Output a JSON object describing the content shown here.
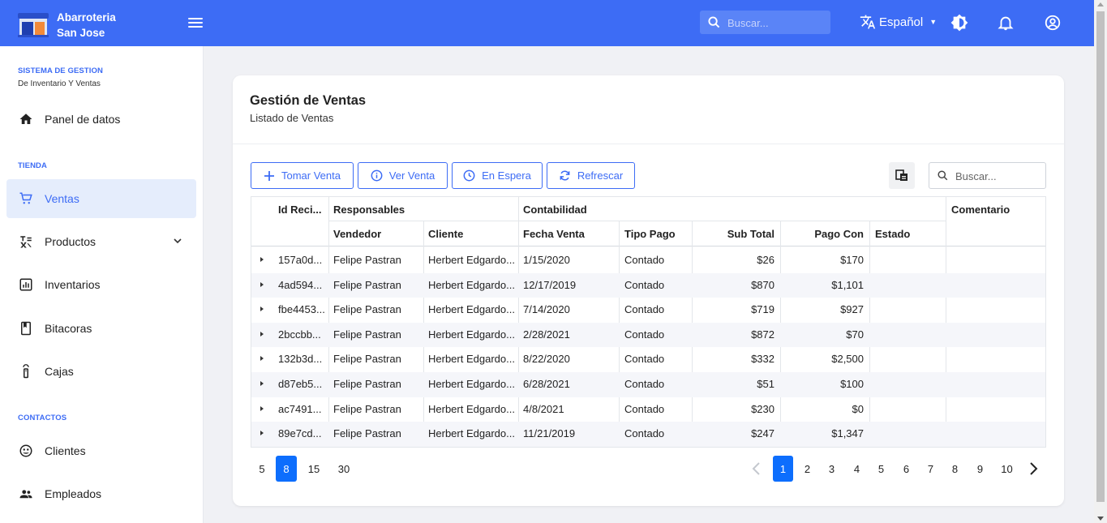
{
  "header": {
    "brand_line1": "Abarroteria",
    "brand_line2": "San Jose",
    "search_placeholder": "Buscar...",
    "language": "Español",
    "accent_color": "#3d6cf5",
    "icons": [
      "menu-icon",
      "search-icon",
      "translate-icon",
      "theme-toggle-icon",
      "bell-icon",
      "account-icon"
    ]
  },
  "sidebar": {
    "system_title": "SISTEMA DE GESTION",
    "system_subtitle": "De Inventario Y Ventas",
    "dashboard_label": "Panel de datos",
    "store_section": "TIENDA",
    "store_items": [
      {
        "label": "Ventas",
        "icon": "cart-icon",
        "active": true
      },
      {
        "label": "Productos",
        "icon": "products-icon",
        "has_submenu": true
      },
      {
        "label": "Inventarios",
        "icon": "chart-icon"
      },
      {
        "label": "Bitacoras",
        "icon": "book-icon"
      },
      {
        "label": "Cajas",
        "icon": "cash-register-icon"
      }
    ],
    "contacts_section": "CONTACTOS",
    "contact_items": [
      {
        "label": "Clientes",
        "icon": "clients-icon"
      },
      {
        "label": "Empleados",
        "icon": "employees-icon"
      }
    ]
  },
  "card": {
    "title": "Gestión de Ventas",
    "subtitle": "Listado de Ventas",
    "buttons": {
      "take_sale": "Tomar Venta",
      "view_sale": "Ver Venta",
      "on_hold": "En Espera",
      "refresh": "Refrescar"
    },
    "search_placeholder": "Buscar..."
  },
  "table": {
    "group_headers": {
      "id": "Id Reci...",
      "responsables": "Responsables",
      "contabilidad": "Contabilidad",
      "comentario": "Comentario"
    },
    "columns": {
      "vendedor": "Vendedor",
      "cliente": "Cliente",
      "fecha": "Fecha Venta",
      "tipo": "Tipo Pago",
      "subtotal": "Sub Total",
      "pago": "Pago Con",
      "estado": "Estado"
    },
    "rows": [
      {
        "id": "157a0d...",
        "vendedor": "Felipe Pastran",
        "cliente": "Herbert Edgardo...",
        "fecha": "1/15/2020",
        "tipo": "Contado",
        "subtotal": "$26",
        "pago": "$170",
        "estado": "",
        "comentario": ""
      },
      {
        "id": "4ad594...",
        "vendedor": "Felipe Pastran",
        "cliente": "Herbert Edgardo...",
        "fecha": "12/17/2019",
        "tipo": "Contado",
        "subtotal": "$870",
        "pago": "$1,101",
        "estado": "",
        "comentario": ""
      },
      {
        "id": "fbe4453...",
        "vendedor": "Felipe Pastran",
        "cliente": "Herbert Edgardo...",
        "fecha": "7/14/2020",
        "tipo": "Contado",
        "subtotal": "$719",
        "pago": "$927",
        "estado": "",
        "comentario": ""
      },
      {
        "id": "2bccbb...",
        "vendedor": "Felipe Pastran",
        "cliente": "Herbert Edgardo...",
        "fecha": "2/28/2021",
        "tipo": "Contado",
        "subtotal": "$872",
        "pago": "$70",
        "estado": "",
        "comentario": ""
      },
      {
        "id": "132b3d...",
        "vendedor": "Felipe Pastran",
        "cliente": "Herbert Edgardo...",
        "fecha": "8/22/2020",
        "tipo": "Contado",
        "subtotal": "$332",
        "pago": "$2,500",
        "estado": "",
        "comentario": ""
      },
      {
        "id": "d87eb5...",
        "vendedor": "Felipe Pastran",
        "cliente": "Herbert Edgardo...",
        "fecha": "6/28/2021",
        "tipo": "Contado",
        "subtotal": "$51",
        "pago": "$100",
        "estado": "",
        "comentario": ""
      },
      {
        "id": "ac7491...",
        "vendedor": "Felipe Pastran",
        "cliente": "Herbert Edgardo...",
        "fecha": "4/8/2021",
        "tipo": "Contado",
        "subtotal": "$230",
        "pago": "$0",
        "estado": "",
        "comentario": ""
      },
      {
        "id": "89e7cd...",
        "vendedor": "Felipe Pastran",
        "cliente": "Herbert Edgardo...",
        "fecha": "11/21/2019",
        "tipo": "Contado",
        "subtotal": "$247",
        "pago": "$1,347",
        "estado": "",
        "comentario": ""
      }
    ]
  },
  "pagination": {
    "page_sizes": [
      "5",
      "8",
      "15",
      "30"
    ],
    "active_page_size": "8",
    "pages": [
      "1",
      "2",
      "3",
      "4",
      "5",
      "6",
      "7",
      "8",
      "9",
      "10"
    ],
    "active_page": "1"
  }
}
